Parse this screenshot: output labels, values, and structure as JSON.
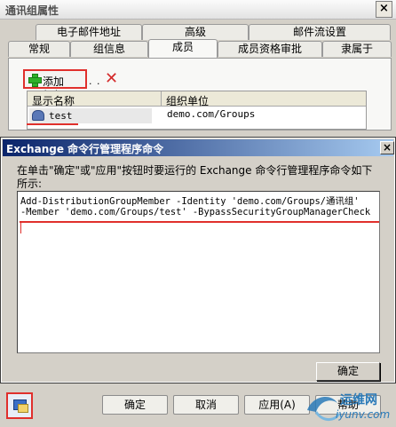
{
  "window": {
    "title": "通讯组属性",
    "close_glyph": "×"
  },
  "tabs_top": [
    "电子邮件地址",
    "高级",
    "邮件流设置"
  ],
  "tabs_bottom": [
    "常规",
    "组信息",
    "成员",
    "成员资格审批",
    "隶属于"
  ],
  "active_tab": "成员",
  "members": {
    "add_label": "添加(D)...",
    "separator": ". .",
    "delete_glyph": "✕",
    "columns": [
      "显示名称",
      "组织单位"
    ],
    "rows": [
      {
        "name": "test",
        "org": "demo.com/Groups"
      }
    ]
  },
  "dialog": {
    "title": "Exchange 命令行管理程序命令",
    "close_glyph": "×",
    "description": "在单击\"确定\"或\"应用\"按钮时要运行的 Exchange 命令行管理程序命令如下所示:",
    "command_lines": [
      "Add-DistributionGroupMember -Identity 'demo.com/Groups/通讯组'",
      "-Member 'demo.com/Groups/test' -BypassSecurityGroupManagerCheck"
    ],
    "ok_label": "确定"
  },
  "buttons": {
    "ok": "确定",
    "cancel": "取消",
    "apply": "应用(A)",
    "help": "帮助"
  },
  "watermark": {
    "text1": "运维网",
    "text2": "iyunv.com"
  },
  "icons": {
    "add": "plus-icon",
    "delete": "delete-x-icon",
    "member": "user-group-icon",
    "command": "shell-command-icon"
  },
  "colors": {
    "highlight": "#e0302c",
    "title_gradient_start": "#0a246a",
    "title_gradient_end": "#a6caf0"
  }
}
